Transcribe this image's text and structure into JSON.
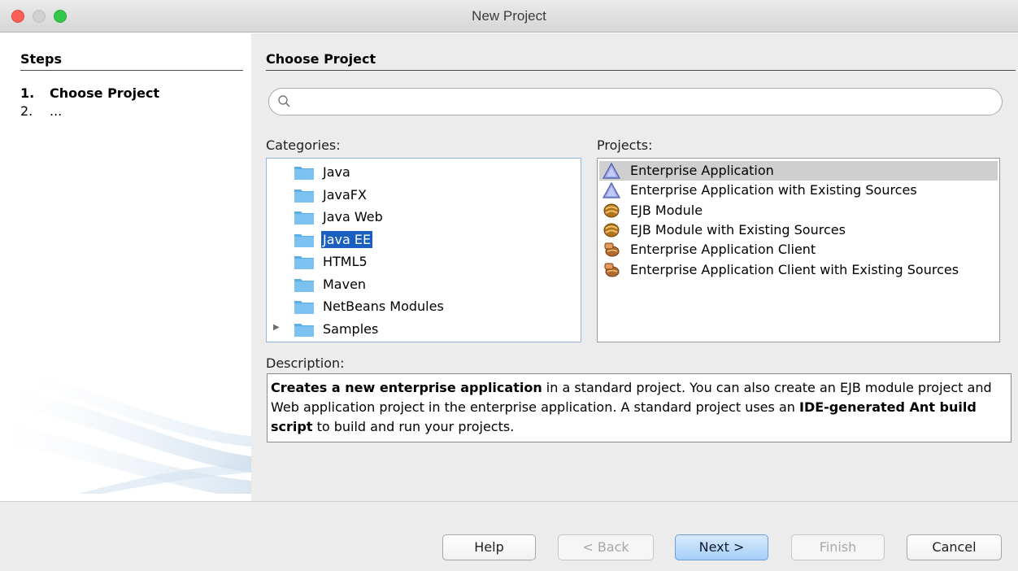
{
  "window": {
    "title": "New Project"
  },
  "steps": {
    "heading": "Steps",
    "items": [
      {
        "number": "1.",
        "label": "Choose Project"
      },
      {
        "number": "2.",
        "label": "..."
      }
    ]
  },
  "main": {
    "heading": "Choose Project",
    "search": {
      "value": "",
      "placeholder": ""
    },
    "categories_label": "Categories:",
    "categories": [
      {
        "label": "Java",
        "selected": false,
        "expandable": false
      },
      {
        "label": "JavaFX",
        "selected": false,
        "expandable": false
      },
      {
        "label": "Java Web",
        "selected": false,
        "expandable": false
      },
      {
        "label": "Java EE",
        "selected": true,
        "expandable": false
      },
      {
        "label": "HTML5",
        "selected": false,
        "expandable": false
      },
      {
        "label": "Maven",
        "selected": false,
        "expandable": false
      },
      {
        "label": "NetBeans Modules",
        "selected": false,
        "expandable": false
      },
      {
        "label": "Samples",
        "selected": false,
        "expandable": true
      }
    ],
    "projects_label": "Projects:",
    "projects": [
      {
        "label": "Enterprise Application",
        "icon": "enterprise-app-icon",
        "selected": true
      },
      {
        "label": "Enterprise Application with Existing Sources",
        "icon": "enterprise-app-icon",
        "selected": false
      },
      {
        "label": "EJB Module",
        "icon": "ejb-bean-icon",
        "selected": false
      },
      {
        "label": "EJB Module with Existing Sources",
        "icon": "ejb-bean-icon",
        "selected": false
      },
      {
        "label": "Enterprise Application Client",
        "icon": "app-client-icon",
        "selected": false
      },
      {
        "label": "Enterprise Application Client with Existing Sources",
        "icon": "app-client-icon",
        "selected": false
      }
    ],
    "description_label": "Description:",
    "description": {
      "part1_bold": "Creates a new enterprise application",
      "part2": " in a standard project. You can also create an EJB module project and Web application project in the enterprise application. A standard project uses an ",
      "part3_bold": "IDE-generated Ant build script",
      "part4": " to build and run your projects."
    }
  },
  "buttons": {
    "help": "Help",
    "back": "< Back",
    "next": "Next >",
    "finish": "Finish",
    "cancel": "Cancel"
  },
  "colors": {
    "selection": "#1a5fc0",
    "folder": "#5aaee6",
    "default_button": "#a7cff8"
  }
}
